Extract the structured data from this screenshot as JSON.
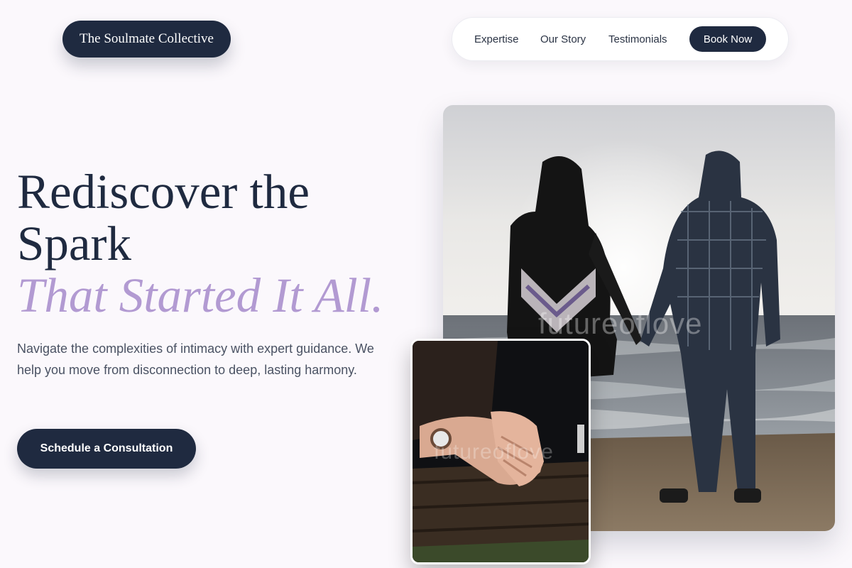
{
  "brand": {
    "name": "The Soulmate Collective"
  },
  "nav": {
    "links": [
      "Expertise",
      "Our Story",
      "Testimonials"
    ],
    "cta": "Book Now"
  },
  "hero": {
    "title_line1": "Rediscover the",
    "title_line2": "Spark",
    "title_accent": "That Started It All.",
    "description": "Navigate the complexities of intimacy with expert guidance. We help you move from disconnection to deep, lasting harmony.",
    "cta": "Schedule a Consultation"
  },
  "images": {
    "main_watermark": "futureoflove",
    "small_watermark": "futureoflove"
  },
  "colors": {
    "background": "#fbf8fc",
    "primary_dark": "#1f2a40",
    "accent_lavender": "#b29ad2",
    "body_text": "#4a5263"
  }
}
